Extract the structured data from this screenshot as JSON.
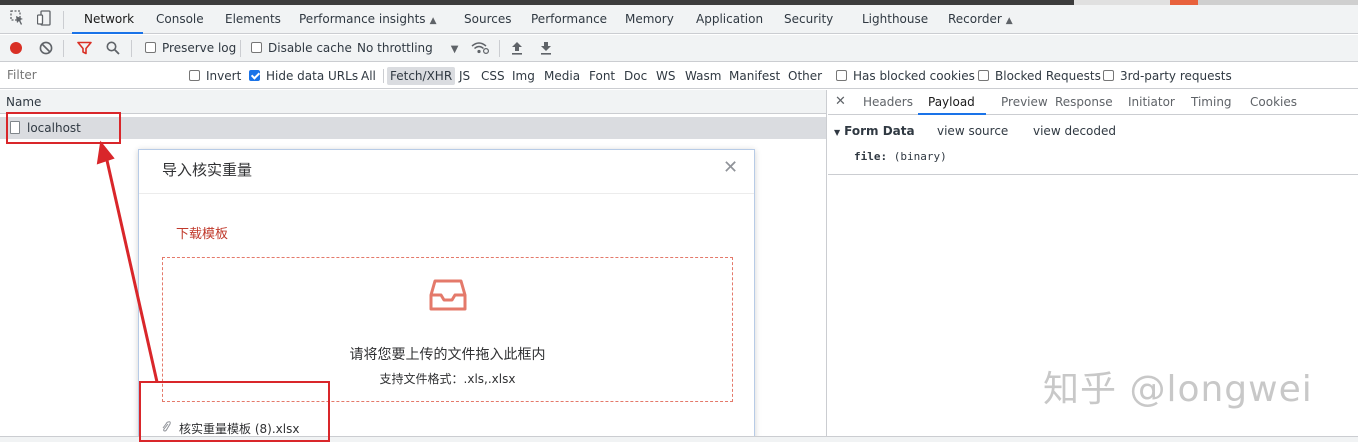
{
  "devtools": {
    "tabs": [
      {
        "label": "Network"
      },
      {
        "label": "Console"
      },
      {
        "label": "Elements"
      },
      {
        "label": "Performance insights"
      },
      {
        "label": "Sources"
      },
      {
        "label": "Performance"
      },
      {
        "label": "Memory"
      },
      {
        "label": "Application"
      },
      {
        "label": "Security"
      },
      {
        "label": "Lighthouse"
      },
      {
        "label": "Recorder"
      }
    ],
    "active_tab": "Network",
    "accent_color": "#1a73e8"
  },
  "toolbar": {
    "preserve_log": {
      "label": "Preserve log",
      "checked": false
    },
    "disable_cache": {
      "label": "Disable cache",
      "checked": false
    },
    "throttling": "No throttling",
    "record_color": "#d93025",
    "filter_icon_color": "#d93025"
  },
  "filterbar": {
    "filter_placeholder": "Filter",
    "invert": {
      "label": "Invert",
      "checked": false
    },
    "hide_data_urls": {
      "label": "Hide data URLs",
      "checked": true
    },
    "types": [
      "All",
      "Fetch/XHR",
      "JS",
      "CSS",
      "Img",
      "Media",
      "Font",
      "Doc",
      "WS",
      "Wasm",
      "Manifest",
      "Other"
    ],
    "selected_type": "Fetch/XHR",
    "blocked_cookies": {
      "label": "Has blocked cookies",
      "checked": false
    },
    "blocked_requests": {
      "label": "Blocked Requests",
      "checked": false
    },
    "third_party": {
      "label": "3rd-party requests",
      "checked": false
    }
  },
  "requests": {
    "column_name": "Name",
    "rows": [
      {
        "name": "localhost"
      }
    ]
  },
  "details": {
    "tabs": [
      "Headers",
      "Payload",
      "Preview",
      "Response",
      "Initiator",
      "Timing",
      "Cookies"
    ],
    "active_tab": "Payload",
    "form_data": {
      "title": "Form Data",
      "view_source": "view source",
      "view_decoded": "view decoded",
      "fields": [
        {
          "key": "file:",
          "value": "(binary)"
        }
      ]
    }
  },
  "dialog": {
    "title": "导入核实重量",
    "download_link": "下载模板",
    "drop_text": "请将您要上传的文件拖入此框内",
    "format_hint": "支持文件格式：.xls,.xlsx",
    "file_name": "核实重量模板 (8).xlsx",
    "accent_color": "#e4796a"
  },
  "watermark": "知乎 @longwei",
  "annotation_color": "#d9262a"
}
